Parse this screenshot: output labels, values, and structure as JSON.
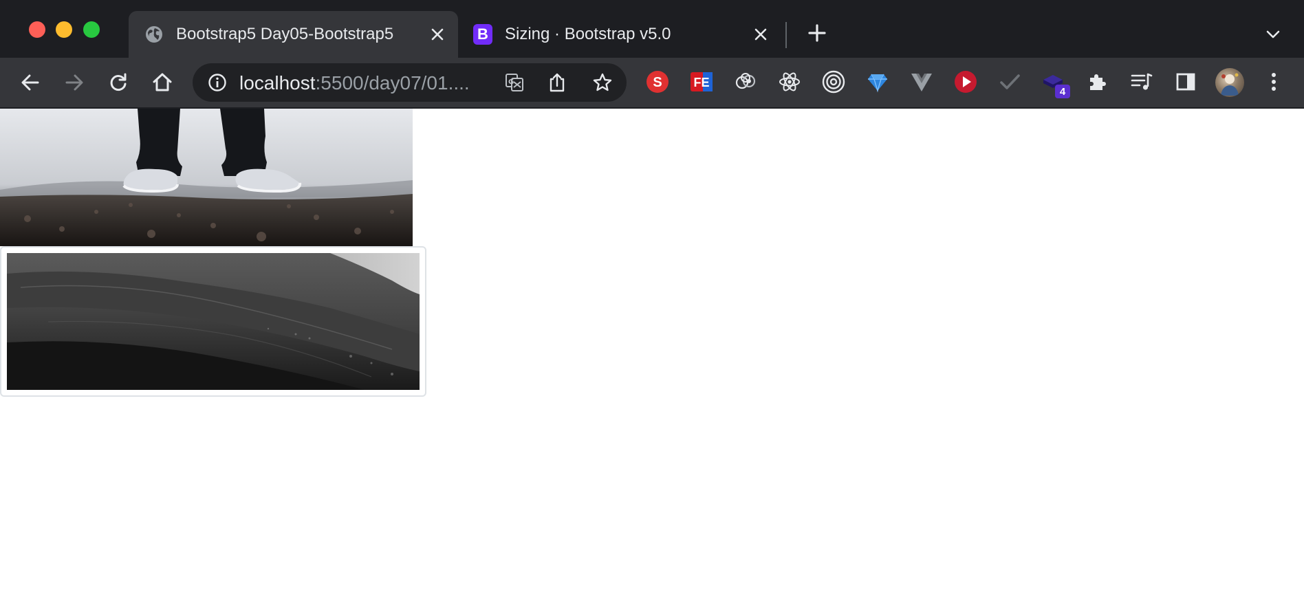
{
  "window": {
    "controls": [
      "close-dot",
      "minimize-dot",
      "maximize-dot"
    ]
  },
  "tabs": [
    {
      "title": "Bootstrap5 Day05-Bootstrap5",
      "icon": "globe-icon",
      "active": true
    },
    {
      "title": "Sizing · Bootstrap v5.0",
      "icon": "bootstrap-logo",
      "favicon_letter": "B",
      "active": false
    }
  ],
  "toolbar": {
    "url_host": "localhost",
    "url_rest": ":5500/day07/01...."
  },
  "extensions": [
    {
      "name": "s-extension-icon",
      "letter": "S",
      "color": "#e03131"
    },
    {
      "name": "fe-extension-icon",
      "letter": "FE",
      "color": "#d71921"
    },
    {
      "name": "gears-extension-icon"
    },
    {
      "name": "react-devtools-icon"
    },
    {
      "name": "target-extension-icon"
    },
    {
      "name": "gem-extension-icon"
    },
    {
      "name": "vue-devtools-icon"
    },
    {
      "name": "play-extension-icon"
    },
    {
      "name": "check-extension-icon"
    },
    {
      "name": "stack-extension-icon",
      "badge": "4"
    },
    {
      "name": "puzzle-extensions-icon"
    },
    {
      "name": "reading-list-icon"
    },
    {
      "name": "side-panel-icon"
    }
  ],
  "colors": {
    "titlebar": "#1d1e22",
    "toolbar": "#35363a",
    "omnibox": "#202124",
    "bootstrap_purple": "#712cf9",
    "thumbnail_border": "#dee2e6"
  },
  "page": {
    "images": [
      {
        "name": "cropped-photo",
        "depicts": "sneakers"
      },
      {
        "name": "thumbnail-photo",
        "depicts": "dark hills"
      }
    ]
  }
}
